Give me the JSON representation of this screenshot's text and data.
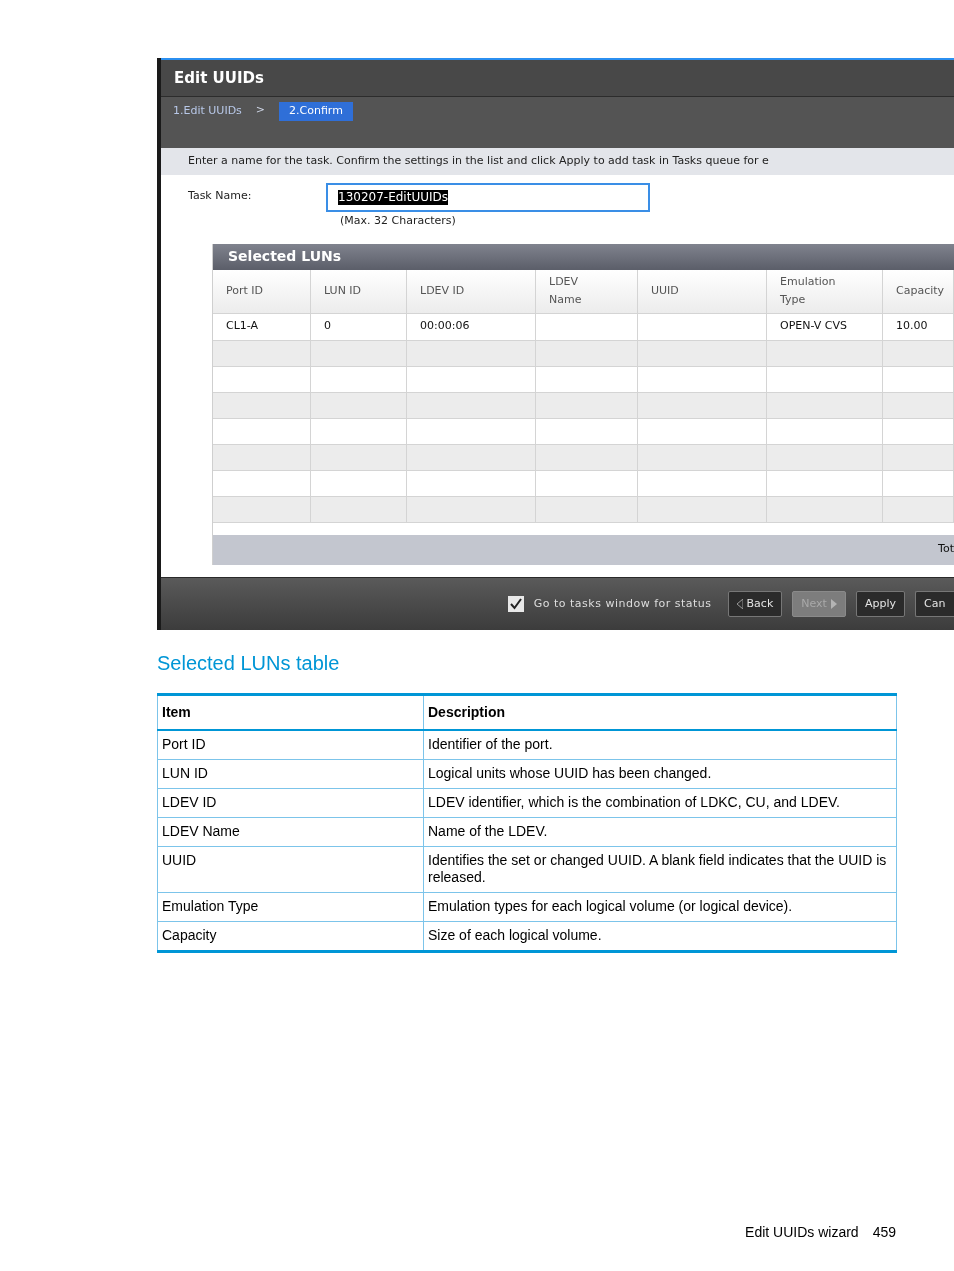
{
  "window": {
    "title": "Edit UUIDs"
  },
  "steps": [
    {
      "label": "1.Edit UUIDs",
      "selected": false
    },
    {
      "label": "2.Confirm",
      "selected": true
    }
  ],
  "step_separator": ">",
  "instruction": "Enter a name for the task. Confirm the settings in the list and click Apply to add task in Tasks queue for e",
  "task_name": {
    "label": "Task Name:",
    "value": "130207-EditUUIDs",
    "hint": "(Max. 32 Characters)"
  },
  "panel": {
    "title": "Selected LUNs",
    "columns": [
      "Port ID",
      "LUN ID",
      "LDEV ID",
      "LDEV Name",
      "UUID",
      "Emulation Type",
      "Capacity"
    ],
    "rows": [
      [
        "CL1-A",
        "0",
        "00:00:06",
        null,
        null,
        "OPEN-V CVS",
        "10.00"
      ]
    ],
    "footer": "Tot"
  },
  "go_to_tasks": {
    "label": "Go to tasks window for status",
    "checked": true
  },
  "buttons": [
    {
      "label": "Back",
      "kind": "back",
      "disabled": false
    },
    {
      "label": "Next",
      "kind": "next",
      "disabled": true
    },
    {
      "label": "Apply",
      "kind": "plain",
      "disabled": false
    },
    {
      "label": "Can",
      "kind": "plain",
      "disabled": false
    }
  ],
  "caption": "Selected LUNs table",
  "doc_table": {
    "columns": [
      "Item",
      "Description"
    ],
    "rows": [
      [
        "Port ID",
        "Identifier of the port."
      ],
      [
        "LUN ID",
        "Logical units whose UUID has been changed."
      ],
      [
        "LDEV ID",
        "LDEV identifier, which is the combination of LDKC, CU, and LDEV."
      ],
      [
        "LDEV Name",
        "Name of the LDEV."
      ],
      [
        "UUID",
        "Identifies the set or changed UUID. A blank field indicates that the UUID is released."
      ],
      [
        "Emulation Type",
        "Emulation types for each logical volume (or logical device)."
      ],
      [
        "Capacity",
        "Size of each logical volume."
      ]
    ]
  },
  "page_footer": {
    "title": "Edit UUIDs wizard",
    "page": "459"
  }
}
